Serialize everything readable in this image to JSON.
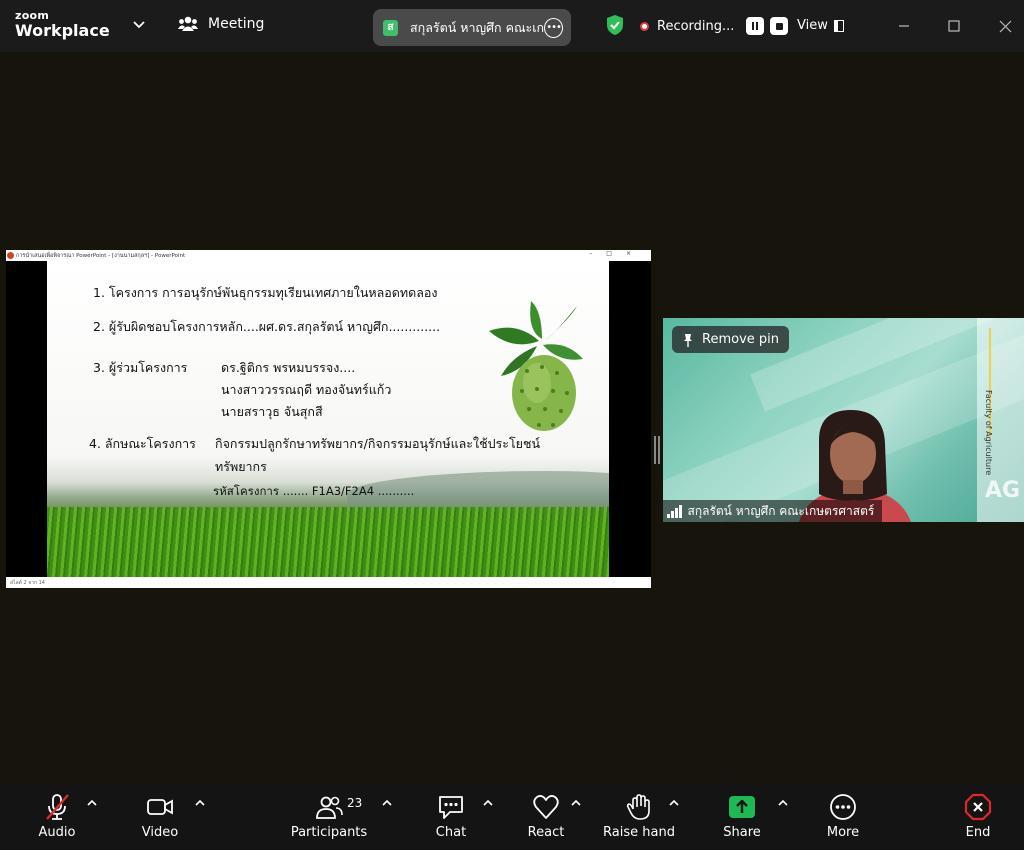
{
  "app": {
    "brand_top": "zoom",
    "brand_bottom": "Workplace"
  },
  "header": {
    "meeting_label": "Meeting",
    "host_pill": {
      "avatar": "ส",
      "name": "สกุลรัตน์ หาญศึก คณะเก"
    },
    "recording_label": "Recording...",
    "view_label": "View"
  },
  "shared_screen": {
    "powerpoint_title": "การนำเสนอเพื่อพิจารณา PowerPoint - [งานนามสกุลฯ] - PowerPoint",
    "status_left": "สไลด์ 2 จาก 14",
    "slide_lines": [
      "1. โครงการ  การอนุรักษ์พันธุกรรมทุเรียนเทศภายในหลอดทดลอง",
      "2. ผู้รับผิดชอบโครงการหลัก....ผศ.ดร.สกุลรัตน์ หาญศึก.............",
      "3. ผู้ร่วมโครงการ",
      "ดร.ฐิติกร พรหมบรรจง....",
      "นางสาววรรณฤดี ทองจันทร์แก้ว",
      "นายสราวุธ จันสุกสี",
      "4. ลักษณะโครงการ",
      "กิจกรรมปลูกรักษาทรัพยากร/กิจกรรมอนุรักษ์และใช้ประโยชน์",
      "ทรัพยากร",
      "รหัสโครงการ ....... F1A3/F2A4 .........."
    ]
  },
  "video_tile": {
    "remove_pin_label": "Remove pin",
    "participant_name": "สกุลรัตน์ หาญศึก คณะเกษตรศาสตร์",
    "background_text": "Faculty of Agriculture",
    "background_mark": "AG"
  },
  "toolbar": {
    "audio_label": "Audio",
    "video_label": "Video",
    "participants_label": "Participants",
    "participants_count": "23",
    "chat_label": "Chat",
    "react_label": "React",
    "raise_hand_label": "Raise hand",
    "share_label": "Share",
    "more_label": "More",
    "end_label": "End"
  },
  "colors": {
    "share_green": "#1db954",
    "end_red": "#e02828",
    "recording_red": "#e23c3c",
    "shield_green": "#2fbf55"
  },
  "icons": [
    "chevron-down-icon",
    "participants-icon",
    "shield-check-icon",
    "pin-icon",
    "signal-icon",
    "mic-muted-icon",
    "video-camera-icon",
    "chat-icon",
    "heart-icon",
    "hand-icon",
    "share-arrow-icon",
    "more-dots-icon",
    "end-icon"
  ]
}
